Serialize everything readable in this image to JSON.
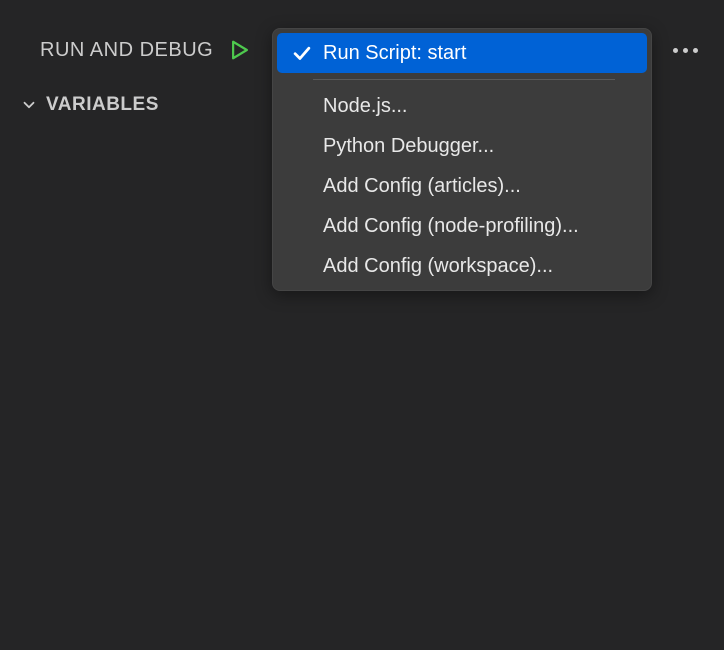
{
  "header": {
    "title": "RUN AND DEBUG"
  },
  "sections": {
    "variables": {
      "title": "VARIABLES"
    }
  },
  "dropdown": {
    "selected": "Run Script: start",
    "items": [
      {
        "label": "Node.js..."
      },
      {
        "label": "Python Debugger..."
      },
      {
        "label": "Add Config (articles)..."
      },
      {
        "label": "Add Config (node-profiling)..."
      },
      {
        "label": "Add Config (workspace)..."
      }
    ]
  }
}
